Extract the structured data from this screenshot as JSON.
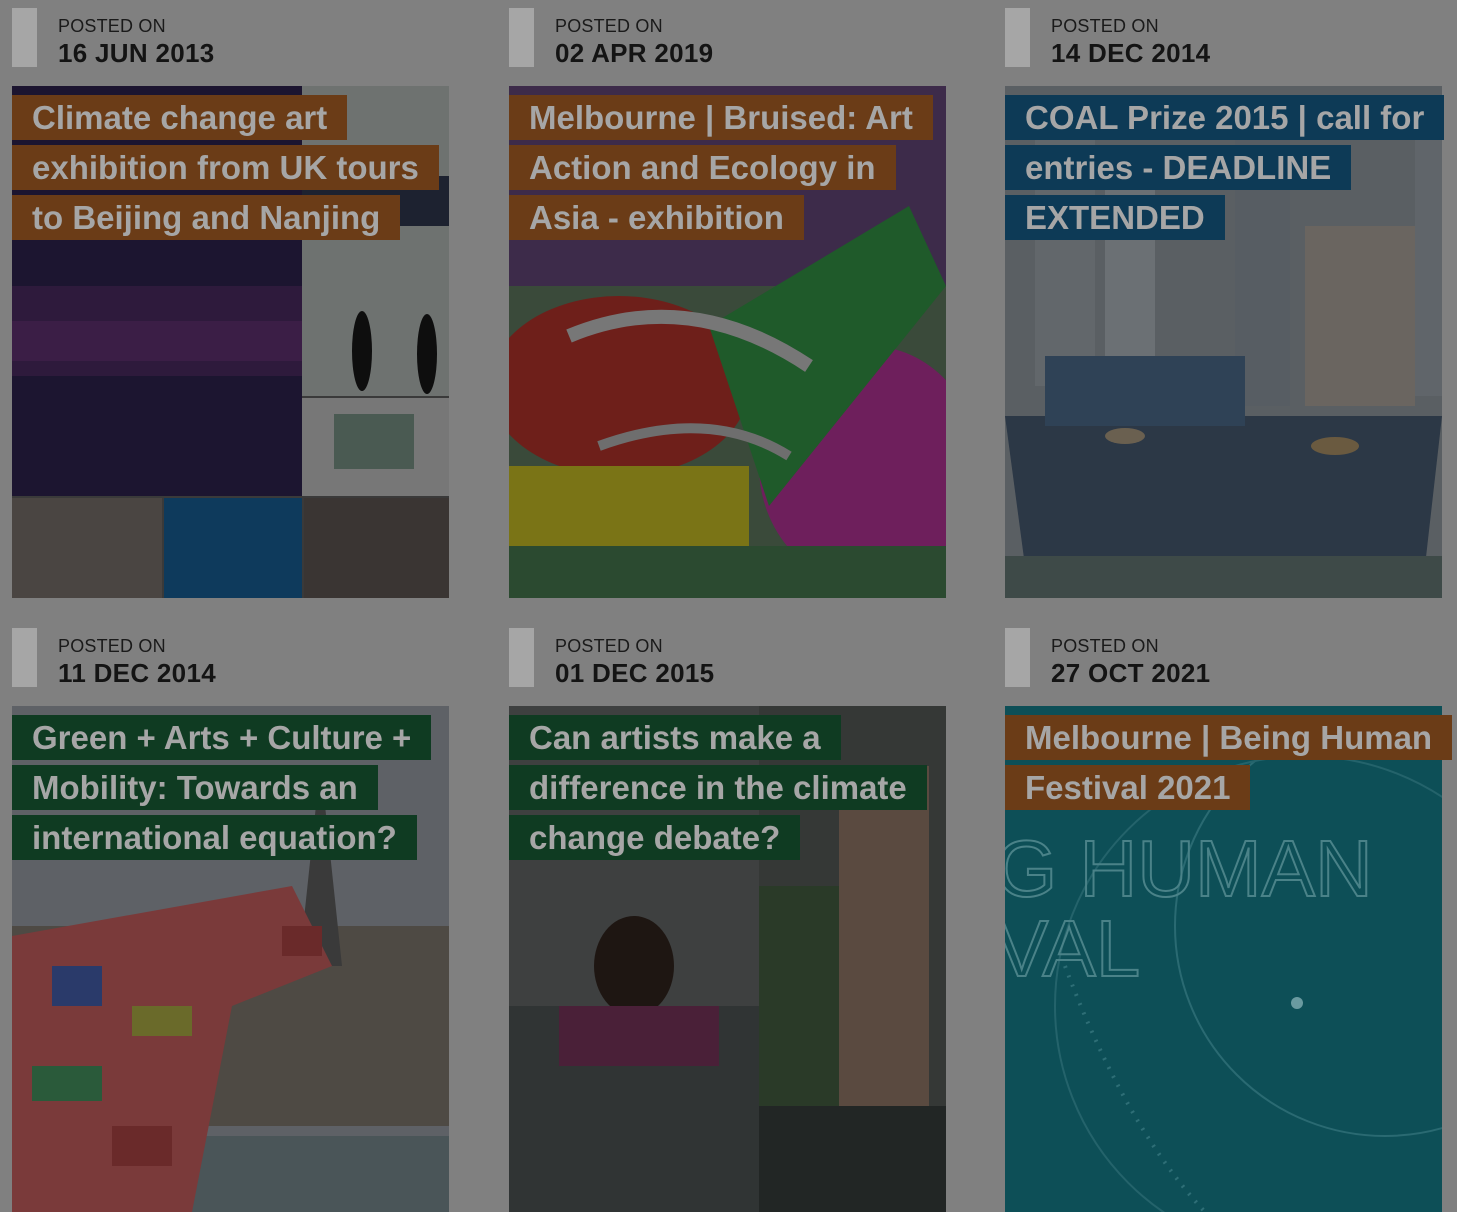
{
  "posts": [
    {
      "posted_label": "POSTED ON",
      "date": "16 JUN 2013",
      "title": "Climate change art exhibition from UK tours to Beijing and Nanjing",
      "title_color": "#6b3c17",
      "image": "climate-collage"
    },
    {
      "posted_label": "POSTED ON",
      "date": "02 APR 2019",
      "title": "Melbourne | Bruised: Art Action and Ecology in Asia - exhibition",
      "title_color": "#6b3c17",
      "image": "fish-baskets"
    },
    {
      "posted_label": "POSTED ON",
      "date": "14 DEC 2014",
      "title": "COAL Prize 2015 | call for entries - DEADLINE EXTENDED",
      "title_color": "#0d3a56",
      "image": "boat-city"
    },
    {
      "posted_label": "POSTED ON",
      "date": "11 DEC 2014",
      "title": "Green + Arts + Culture + Mobility: Towards an international equation?",
      "title_color": "#0f3b22",
      "image": "flags-paris"
    },
    {
      "posted_label": "POSTED ON",
      "date": "01 DEC 2015",
      "title": "Can artists make a difference in the climate change debate?",
      "title_color": "#0f3b22",
      "image": "flood-photos"
    },
    {
      "posted_label": "POSTED ON",
      "date": "27 OCT 2021",
      "title": "Melbourne | Being Human Festival 2021",
      "title_color": "#6b3c17",
      "image": "being-human-poster",
      "image_text": [
        "G HUMAN",
        "VAL"
      ]
    }
  ]
}
